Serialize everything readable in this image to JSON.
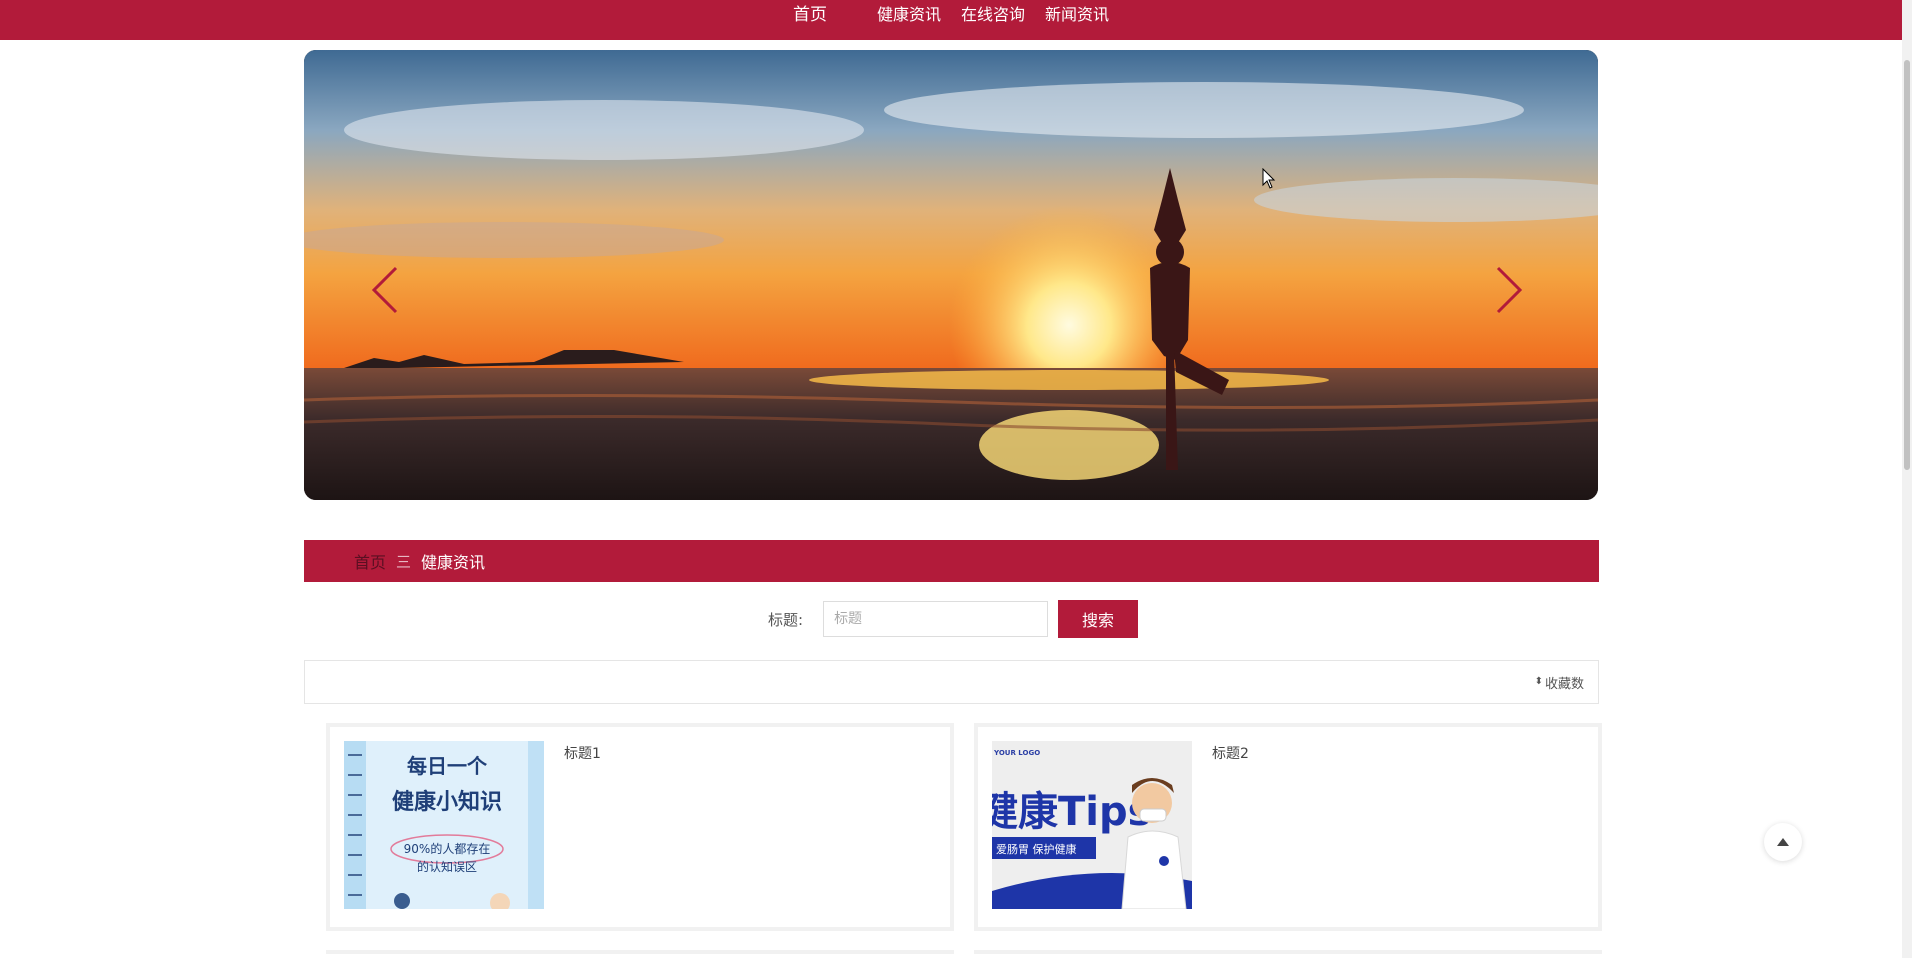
{
  "nav": {
    "items": [
      {
        "label": "首页"
      },
      {
        "label": "健康资讯"
      },
      {
        "label": "在线咨询"
      },
      {
        "label": "新闻资讯"
      }
    ]
  },
  "banner": {
    "icon_prev": "chevron-left-icon",
    "icon_next": "chevron-right-icon"
  },
  "breadcrumb": {
    "home": "首页",
    "separator": "三",
    "current": "健康资讯"
  },
  "search": {
    "label": "标题:",
    "placeholder": "标题",
    "value": "",
    "button": "搜索"
  },
  "sort": {
    "label": "收藏数",
    "icon": "sort-icon"
  },
  "cards": [
    {
      "title": "标题1",
      "thumb": {
        "line1": "每日一个",
        "line2": "健康小知识",
        "line3": "90%的人都存在",
        "line4": "的认知误区"
      }
    },
    {
      "title": "标题2",
      "thumb": {
        "logo": "YOUR LOGO",
        "headline": "健康Tips",
        "sub": "爱肠胃 保护健康"
      }
    }
  ],
  "colors": {
    "brand": "#b21b3a",
    "border": "#e5e5e5"
  }
}
